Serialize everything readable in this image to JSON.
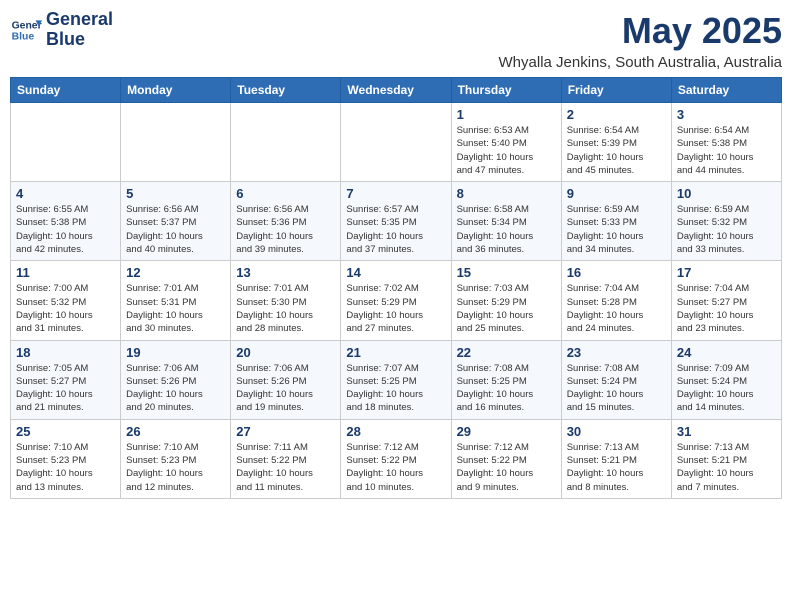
{
  "header": {
    "logo_line1": "General",
    "logo_line2": "Blue",
    "title": "May 2025",
    "subtitle": "Whyalla Jenkins, South Australia, Australia"
  },
  "days_of_week": [
    "Sunday",
    "Monday",
    "Tuesday",
    "Wednesday",
    "Thursday",
    "Friday",
    "Saturday"
  ],
  "weeks": [
    [
      {
        "day": "",
        "info": ""
      },
      {
        "day": "",
        "info": ""
      },
      {
        "day": "",
        "info": ""
      },
      {
        "day": "",
        "info": ""
      },
      {
        "day": "1",
        "info": "Sunrise: 6:53 AM\nSunset: 5:40 PM\nDaylight: 10 hours\nand 47 minutes."
      },
      {
        "day": "2",
        "info": "Sunrise: 6:54 AM\nSunset: 5:39 PM\nDaylight: 10 hours\nand 45 minutes."
      },
      {
        "day": "3",
        "info": "Sunrise: 6:54 AM\nSunset: 5:38 PM\nDaylight: 10 hours\nand 44 minutes."
      }
    ],
    [
      {
        "day": "4",
        "info": "Sunrise: 6:55 AM\nSunset: 5:38 PM\nDaylight: 10 hours\nand 42 minutes."
      },
      {
        "day": "5",
        "info": "Sunrise: 6:56 AM\nSunset: 5:37 PM\nDaylight: 10 hours\nand 40 minutes."
      },
      {
        "day": "6",
        "info": "Sunrise: 6:56 AM\nSunset: 5:36 PM\nDaylight: 10 hours\nand 39 minutes."
      },
      {
        "day": "7",
        "info": "Sunrise: 6:57 AM\nSunset: 5:35 PM\nDaylight: 10 hours\nand 37 minutes."
      },
      {
        "day": "8",
        "info": "Sunrise: 6:58 AM\nSunset: 5:34 PM\nDaylight: 10 hours\nand 36 minutes."
      },
      {
        "day": "9",
        "info": "Sunrise: 6:59 AM\nSunset: 5:33 PM\nDaylight: 10 hours\nand 34 minutes."
      },
      {
        "day": "10",
        "info": "Sunrise: 6:59 AM\nSunset: 5:32 PM\nDaylight: 10 hours\nand 33 minutes."
      }
    ],
    [
      {
        "day": "11",
        "info": "Sunrise: 7:00 AM\nSunset: 5:32 PM\nDaylight: 10 hours\nand 31 minutes."
      },
      {
        "day": "12",
        "info": "Sunrise: 7:01 AM\nSunset: 5:31 PM\nDaylight: 10 hours\nand 30 minutes."
      },
      {
        "day": "13",
        "info": "Sunrise: 7:01 AM\nSunset: 5:30 PM\nDaylight: 10 hours\nand 28 minutes."
      },
      {
        "day": "14",
        "info": "Sunrise: 7:02 AM\nSunset: 5:29 PM\nDaylight: 10 hours\nand 27 minutes."
      },
      {
        "day": "15",
        "info": "Sunrise: 7:03 AM\nSunset: 5:29 PM\nDaylight: 10 hours\nand 25 minutes."
      },
      {
        "day": "16",
        "info": "Sunrise: 7:04 AM\nSunset: 5:28 PM\nDaylight: 10 hours\nand 24 minutes."
      },
      {
        "day": "17",
        "info": "Sunrise: 7:04 AM\nSunset: 5:27 PM\nDaylight: 10 hours\nand 23 minutes."
      }
    ],
    [
      {
        "day": "18",
        "info": "Sunrise: 7:05 AM\nSunset: 5:27 PM\nDaylight: 10 hours\nand 21 minutes."
      },
      {
        "day": "19",
        "info": "Sunrise: 7:06 AM\nSunset: 5:26 PM\nDaylight: 10 hours\nand 20 minutes."
      },
      {
        "day": "20",
        "info": "Sunrise: 7:06 AM\nSunset: 5:26 PM\nDaylight: 10 hours\nand 19 minutes."
      },
      {
        "day": "21",
        "info": "Sunrise: 7:07 AM\nSunset: 5:25 PM\nDaylight: 10 hours\nand 18 minutes."
      },
      {
        "day": "22",
        "info": "Sunrise: 7:08 AM\nSunset: 5:25 PM\nDaylight: 10 hours\nand 16 minutes."
      },
      {
        "day": "23",
        "info": "Sunrise: 7:08 AM\nSunset: 5:24 PM\nDaylight: 10 hours\nand 15 minutes."
      },
      {
        "day": "24",
        "info": "Sunrise: 7:09 AM\nSunset: 5:24 PM\nDaylight: 10 hours\nand 14 minutes."
      }
    ],
    [
      {
        "day": "25",
        "info": "Sunrise: 7:10 AM\nSunset: 5:23 PM\nDaylight: 10 hours\nand 13 minutes."
      },
      {
        "day": "26",
        "info": "Sunrise: 7:10 AM\nSunset: 5:23 PM\nDaylight: 10 hours\nand 12 minutes."
      },
      {
        "day": "27",
        "info": "Sunrise: 7:11 AM\nSunset: 5:22 PM\nDaylight: 10 hours\nand 11 minutes."
      },
      {
        "day": "28",
        "info": "Sunrise: 7:12 AM\nSunset: 5:22 PM\nDaylight: 10 hours\nand 10 minutes."
      },
      {
        "day": "29",
        "info": "Sunrise: 7:12 AM\nSunset: 5:22 PM\nDaylight: 10 hours\nand 9 minutes."
      },
      {
        "day": "30",
        "info": "Sunrise: 7:13 AM\nSunset: 5:21 PM\nDaylight: 10 hours\nand 8 minutes."
      },
      {
        "day": "31",
        "info": "Sunrise: 7:13 AM\nSunset: 5:21 PM\nDaylight: 10 hours\nand 7 minutes."
      }
    ]
  ]
}
